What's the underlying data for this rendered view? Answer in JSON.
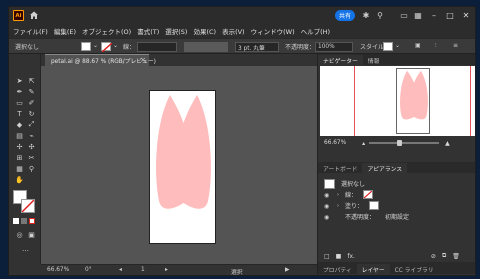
{
  "app": {
    "logo": "Ai",
    "share_label": "共有"
  },
  "menu": [
    "ファイル(F)",
    "編集(E)",
    "オブジェクト(O)",
    "書式(T)",
    "選択(S)",
    "効果(C)",
    "表示(V)",
    "ウィンドウ(W)",
    "ヘルプ(H)"
  ],
  "control": {
    "selection": "選択なし",
    "stroke_label": "線：",
    "stroke_style": "3 pt. 丸筆",
    "opacity_label": "不透明度：",
    "opacity_value": "100%",
    "style_label": "スタイル："
  },
  "document": {
    "tab_title": "petal.ai @ 88.67 % (RGB/プレビュー)",
    "shape_color": "#ffbcbc"
  },
  "status": {
    "zoom": "66.67%",
    "rotation": "0°",
    "page": "1",
    "tool": "選択"
  },
  "navigator": {
    "tabs": [
      "ナビゲーター",
      "情報"
    ],
    "zoom": "66.67%"
  },
  "appearance": {
    "tabs": [
      "アートボード",
      "アピアランス"
    ],
    "title": "選択なし",
    "rows": [
      {
        "label": "線：",
        "eye": true
      },
      {
        "label": "塗り：",
        "eye": true
      },
      {
        "label": "不透明度：",
        "value": "初期設定",
        "eye": true
      }
    ],
    "fx_label": "fx."
  },
  "bottom_tabs": [
    "プロパティ",
    "レイヤー",
    "CC ライブラリ"
  ]
}
